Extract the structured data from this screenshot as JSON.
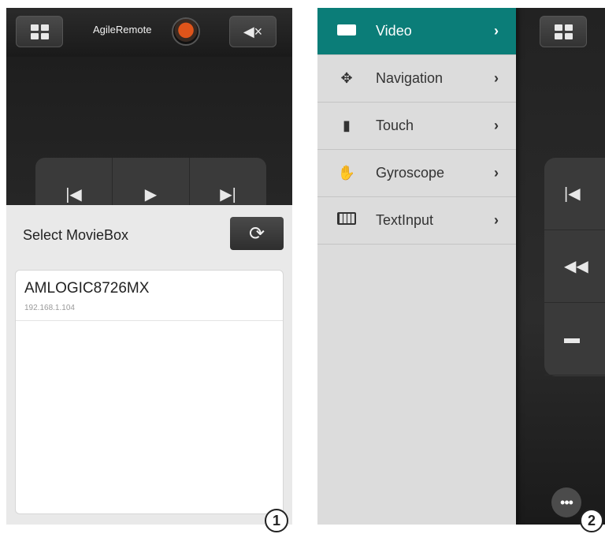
{
  "panel1": {
    "app_title": "AgileRemote",
    "sheet_title": "Select MovieBox",
    "device": {
      "name": "AMLOGIC8726MX",
      "ip": "192.168.1.104"
    },
    "media_controls": [
      "prev-icon",
      "play-icon",
      "next-icon"
    ],
    "step": "1"
  },
  "panel2": {
    "menu": [
      {
        "label": "Video",
        "icon": "video-icon",
        "active": true
      },
      {
        "label": "Navigation",
        "icon": "navigation-icon",
        "active": false
      },
      {
        "label": "Touch",
        "icon": "mouse-icon",
        "active": false
      },
      {
        "label": "Gyroscope",
        "icon": "hand-icon",
        "active": false
      },
      {
        "label": "TextInput",
        "icon": "keyboard-icon",
        "active": false
      }
    ],
    "step": "2"
  },
  "colors": {
    "accent": "#0b7d78",
    "drawer_bg": "#dcdcdc",
    "dark_bg": "#1f1f1f"
  }
}
